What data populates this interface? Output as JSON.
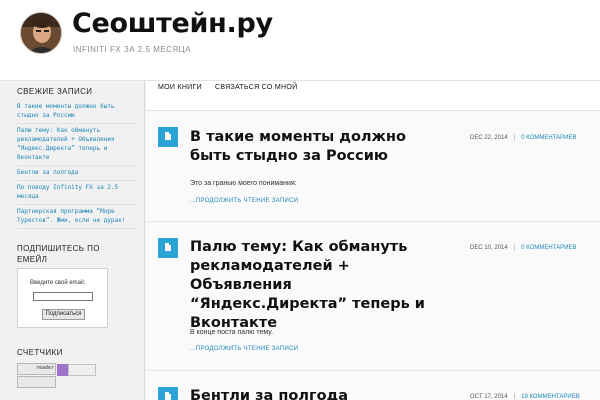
{
  "site": {
    "title": "Сеоштейн.ру",
    "tagline": "INFINITI FX ЗА 2.5 МЕСЯЦА"
  },
  "nav": {
    "items": [
      {
        "label": "МОИ КНИГИ"
      },
      {
        "label": "СВЯЗАТЬСЯ СО МНОЙ"
      }
    ]
  },
  "sidebar": {
    "recent_title": "СВЕЖИЕ ЗАПИСИ",
    "recent_posts": [
      "В такие моменты должно быть стыдно за Россию",
      "Палю тему: Как обмануть рекламодателей + Объявления “Яндекс.Директа” теперь и Вконтакте",
      "Бентли за полгода",
      "По поводу Infinity FX за 2.5 месяца",
      "Партнерская программа “Море Турестов”. Жми, если не дурак!"
    ],
    "subscribe_title_line1": "ПОДПИШИТЕСЬ ПО",
    "subscribe_title_line2": "ЕМЕЙЛ",
    "subscribe_label": "Введите свой email:",
    "subscribe_button": "Подписаться",
    "counters_title": "СЧЕТЧИКИ",
    "counter_text": "reader"
  },
  "posts": [
    {
      "title": "В такие моменты должно быть стыдно за Россию",
      "date": "DEC 22, 2014",
      "comments": "0 КОММЕНТАРИЕВ",
      "excerpt": "Это за гранью моего понимания:",
      "read_more": "...ПРОДОЛЖИТЬ ЧТЕНИЕ ЗАПИСИ"
    },
    {
      "title": "Палю тему: Как обмануть рекламодателей + Объявления “Яндекс.Директа” теперь и Вконтакте",
      "date": "DEC 10, 2014",
      "comments": "0 КОММЕНТАРИЕВ",
      "excerpt": "В конце поста палю тему.",
      "read_more": "...ПРОДОЛЖИТЬ ЧТЕНИЕ ЗАПИСИ"
    },
    {
      "title": "Бентли за полгода",
      "date": "OCT 17, 2014",
      "comments": "19 КОММЕНТАРИЕВ"
    }
  ],
  "colors": {
    "accent": "#2aa4d5",
    "link": "#1f87b8"
  },
  "icons": {
    "post": "document-icon"
  }
}
